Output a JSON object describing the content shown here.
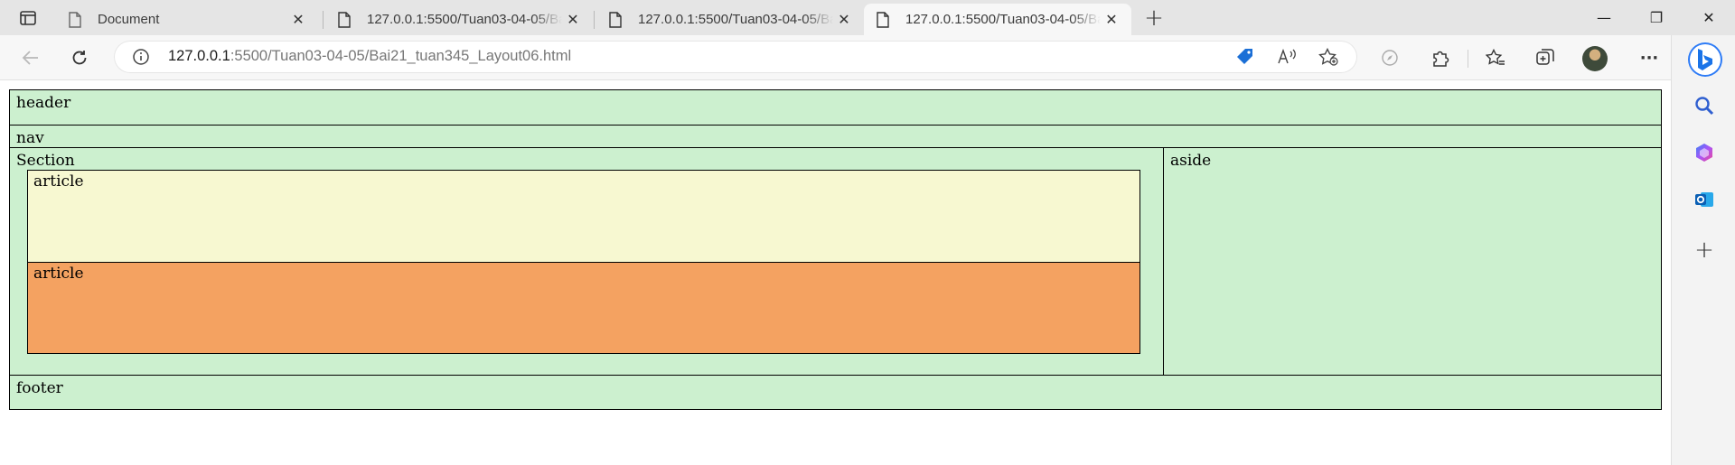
{
  "browser": {
    "tabs": [
      {
        "title": "Document",
        "active": false
      },
      {
        "title": "127.0.0.1:5500/Tuan03-04-05/Bai21_tuan345_Layout06.html",
        "active": false
      },
      {
        "title": "127.0.0.1:5500/Tuan03-04-05/Bai21_tuan345_Layout06.html",
        "active": false
      },
      {
        "title": "127.0.0.1:5500/Tuan03-04-05/Bai21_tuan345_Layout06.html",
        "active": true
      }
    ],
    "new_tab_label": "+",
    "close_label": "✕",
    "window_controls": {
      "minimize": "—",
      "restore": "❐",
      "close": "✕"
    },
    "address": {
      "host": "127.0.0.1",
      "path": ":5500/Tuan03-04-05/Bai21_tuan345_Layout06.html"
    },
    "more_label": "···",
    "sidebar_add_label": "+",
    "colors": {
      "tab_strip": "#e5e5e5",
      "toolbar": "#f7f7f7",
      "accent_blue": "#2e7cf6"
    }
  },
  "page": {
    "header": "header",
    "nav": "nav",
    "section": "Section",
    "article_1": "article",
    "article_2": "article",
    "aside": "aside",
    "footer": "footer",
    "colors": {
      "layout_green": "#ccf0cf",
      "article_light": "#f7f8d1",
      "article_orange": "#f4a261"
    }
  }
}
